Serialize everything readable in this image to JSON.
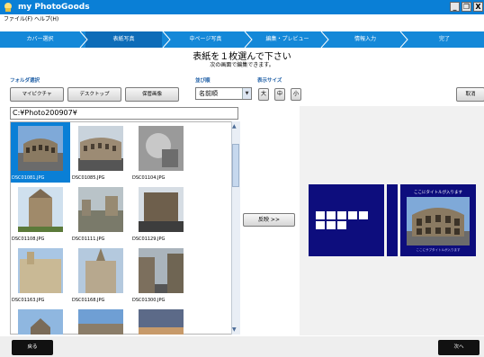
{
  "window": {
    "title": "my PhotoGoods",
    "controls": [
      "_",
      "❐",
      "X"
    ]
  },
  "menu": [
    {
      "label": "ファイル(F)"
    },
    {
      "label": "ヘルプ(H)"
    }
  ],
  "steps": [
    {
      "label": "カバー選択",
      "active": false
    },
    {
      "label": "表紙写真",
      "active": true
    },
    {
      "label": "中ページ写真",
      "active": false
    },
    {
      "label": "編集・プレビュー",
      "active": false
    },
    {
      "label": "情報入力",
      "active": false
    },
    {
      "label": "完了",
      "active": false
    }
  ],
  "heading": {
    "main": "表紙を１枚選んで下さい",
    "sub": "次の画面で編集できます。"
  },
  "folder_select": {
    "label": "フォルダ選択",
    "buttons": [
      "マイピクチャ",
      "デスクトップ",
      "保管画像"
    ]
  },
  "sort": {
    "label": "並び順",
    "value": "名前順"
  },
  "display_size": {
    "label": "表示サイズ",
    "options": [
      "大",
      "中",
      "小"
    ]
  },
  "cancel_label": "取消",
  "path": "C:¥Photo200907¥",
  "thumbnails": [
    {
      "name": "DSC01081.JPG",
      "selected": true
    },
    {
      "name": "DSC01085.JPG",
      "selected": false
    },
    {
      "name": "DSC01104.JPG",
      "selected": false
    },
    {
      "name": "DSC01108.JPG",
      "selected": false
    },
    {
      "name": "DSC01111.JPG",
      "selected": false
    },
    {
      "name": "DSC01129.JPG",
      "selected": false
    },
    {
      "name": "DSC01163.JPG",
      "selected": false
    },
    {
      "name": "DSC01168.JPG",
      "selected": false
    },
    {
      "name": "DSC01300.JPG",
      "selected": false
    },
    {
      "name": "",
      "selected": false
    },
    {
      "name": "",
      "selected": false
    },
    {
      "name": "",
      "selected": false
    }
  ],
  "insert_label": "反映 >>",
  "preview": {
    "cover_title": "ここにタイトルが入ります",
    "cover_subtitle": "ここにサブタイトルが入ります"
  },
  "footer": {
    "back": "戻る",
    "next": "次へ"
  },
  "colors": {
    "titlebar": "#0a7fd6",
    "stepbar": "#1488d8",
    "cover": "#0d0d7d"
  }
}
